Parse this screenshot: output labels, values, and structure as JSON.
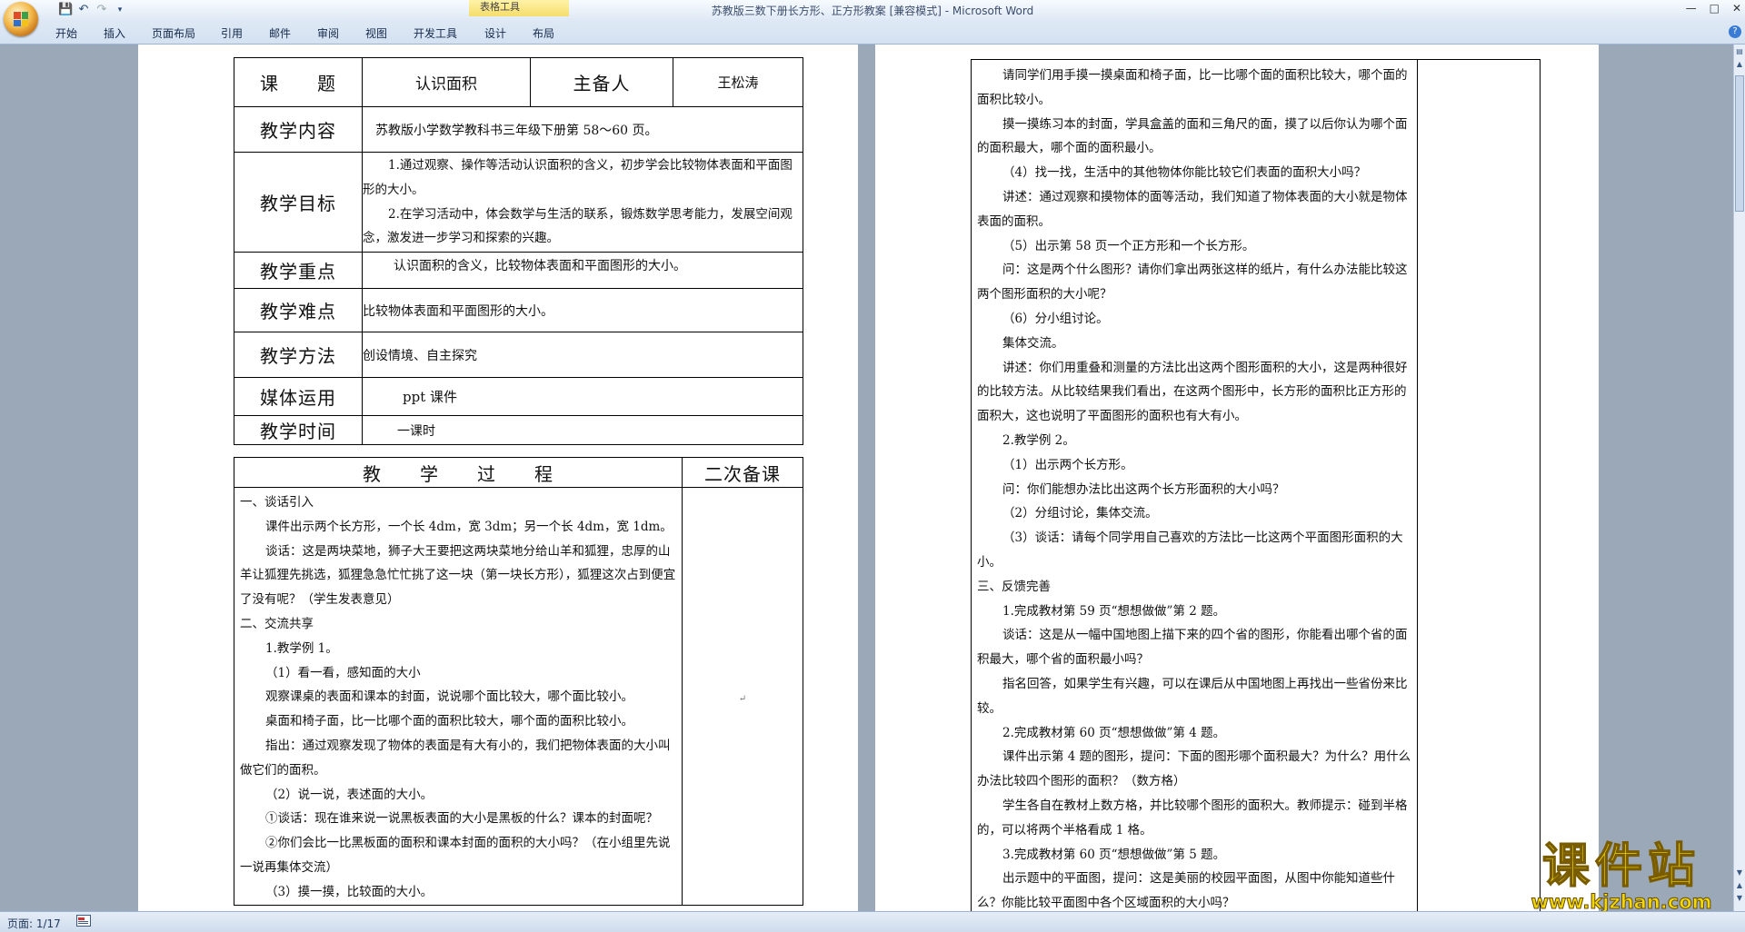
{
  "window": {
    "title": "苏教版三数下册长方形、正方形教案 [兼容模式] - Microsoft Word",
    "context_tab_group": "表格工具"
  },
  "ribbon": {
    "tabs": [
      "开始",
      "插入",
      "页面布局",
      "引用",
      "邮件",
      "审阅",
      "视图",
      "开发工具",
      "设计",
      "布局"
    ]
  },
  "status": {
    "page": "页面: 1/17"
  },
  "watermark": {
    "brand": "课件站",
    "url": "www.kjzhan.com"
  },
  "doc": {
    "topic_label": "课　　题",
    "topic_value": "认识面积",
    "preparer_label": "主备人",
    "preparer_value": "王松涛",
    "content_label": "教学内容",
    "content_value": "苏教版小学数学教科书三年级下册第 58～60 页。",
    "goals_label": "教学目标",
    "goal1": "1.通过观察、操作等活动认识面积的含义，初步学会比较物体表面和平面图形的大小。",
    "goal2": "2.在学习活动中，体会数学与生活的联系，锻炼数学思考能力，发展空间观念，激发进一步学习和探索的兴趣。",
    "key_label": "教学重点",
    "key_value": "认识面积的含义，比较物体表面和平面图形的大小。",
    "difficulty_label": "教学难点",
    "difficulty_value": "比较物体表面和平面图形的大小。",
    "method_label": "教学方法",
    "method_value": "创设情境、自主探究",
    "media_label": "媒体运用",
    "media_value": "ppt 课件",
    "time_label": "教学时间",
    "time_value": "一课时",
    "process_header": "教　　学　　过　　程",
    "second_prep_header": "二次备课",
    "process_left": [
      {
        "text": "一、谈话引入",
        "indent": false
      },
      {
        "text": "课件出示两个长方形，一个长 4dm，宽 3dm；另一个长 4dm，宽 1dm。",
        "indent": true
      },
      {
        "text": "谈话：这是两块菜地，狮子大王要把这两块菜地分给山羊和狐狸，忠厚的山羊让狐狸先挑选，狐狸急急忙忙挑了这一块（第一块长方形），狐狸这次占到便宜了没有呢？（学生发表意见）",
        "indent": true
      },
      {
        "text": "二、交流共享",
        "indent": false
      },
      {
        "text": "1.教学例 1。",
        "indent": true
      },
      {
        "text": "（1）看一看，感知面的大小",
        "indent": true
      },
      {
        "text": "观察课桌的表面和课本的封面，说说哪个面比较大，哪个面比较小。",
        "indent": true
      },
      {
        "text": "桌面和椅子面，比一比哪个面的面积比较大，哪个面的面积比较小。",
        "indent": true
      },
      {
        "text": "指出：通过观察发现了物体的表面是有大有小的，我们把物体表面的大小叫做它们的面积。",
        "indent": true
      },
      {
        "text": "（2）说一说，表述面的大小。",
        "indent": true
      },
      {
        "text": "①谈话：现在谁来说一说黑板表面的大小是黑板的什么？课本的封面呢？",
        "indent": true
      },
      {
        "text": "②你们会比一比黑板面的面积和课本封面的面积的大小吗？（在小组里先说一说再集体交流）",
        "indent": true
      },
      {
        "text": "（3）摸一摸，比较面的大小。",
        "indent": true
      }
    ],
    "process_right": [
      {
        "text": "请同学们用手摸一摸桌面和椅子面，比一比哪个面的面积比较大，哪个面的面积比较小。",
        "indent": true
      },
      {
        "text": "摸一摸练习本的封面，学具盒盖的面和三角尺的面，摸了以后你认为哪个面的面积最大，哪个面的面积最小。",
        "indent": true
      },
      {
        "text": "（4）找一找，生活中的其他物体你能比较它们表面的面积大小吗？",
        "indent": true
      },
      {
        "text": "讲述：通过观察和摸物体的面等活动，我们知道了物体表面的大小就是物体表面的面积。",
        "indent": true
      },
      {
        "text": "（5）出示第 58 页一个正方形和一个长方形。",
        "indent": true
      },
      {
        "text": "问：这是两个什么图形？请你们拿出两张这样的纸片，有什么办法能比较这两个图形面积的大小呢？",
        "indent": true
      },
      {
        "text": "（6）分小组讨论。",
        "indent": true
      },
      {
        "text": "集体交流。",
        "indent": true
      },
      {
        "text": "讲述：你们用重叠和测量的方法比出这两个图形面积的大小，这是两种很好的比较方法。从比较结果我们看出，在这两个图形中，长方形的面积比正方形的面积大，这也说明了平面图形的面积也有大有小。",
        "indent": true
      },
      {
        "text": "2.教学例 2。",
        "indent": true
      },
      {
        "text": "（1）出示两个长方形。",
        "indent": true
      },
      {
        "text": "问：你们能想办法比出这两个长方形面积的大小吗？",
        "indent": true
      },
      {
        "text": "（2）分组讨论，集体交流。",
        "indent": true
      },
      {
        "text": "（3）谈话：请每个同学用自己喜欢的方法比一比这两个平面图形面积的大小。",
        "indent": true
      },
      {
        "text": "三、反馈完善",
        "indent": false
      },
      {
        "text": "1.完成教材第 59 页“想想做做”第 2 题。",
        "indent": true
      },
      {
        "text": "谈话：这是从一幅中国地图上描下来的四个省的图形，你能看出哪个省的面积最大，哪个省的面积最小吗？",
        "indent": true
      },
      {
        "text": "指名回答，如果学生有兴趣，可以在课后从中国地图上再找出一些省份来比较。",
        "indent": true
      },
      {
        "text": "2.完成教材第 60 页“想想做做”第 4 题。",
        "indent": true
      },
      {
        "text": "课件出示第 4 题的图形，提问：下面的图形哪个面积最大？为什么？用什么办法比较四个图形的面积？（数方格）",
        "indent": true
      },
      {
        "text": "学生各自在教材上数方格，并比较哪个图形的面积大。教师提示：碰到半格的，可以将两个半格看成 1 格。",
        "indent": true
      },
      {
        "text": "3.完成教材第 60 页“想想做做”第 5 题。",
        "indent": true
      },
      {
        "text": "出示题中的平面图，提问：这是美丽的校园平面图，从图中你能知道些什么？你能比较平面图中各个区域面积的大小吗？",
        "indent": true
      }
    ]
  }
}
